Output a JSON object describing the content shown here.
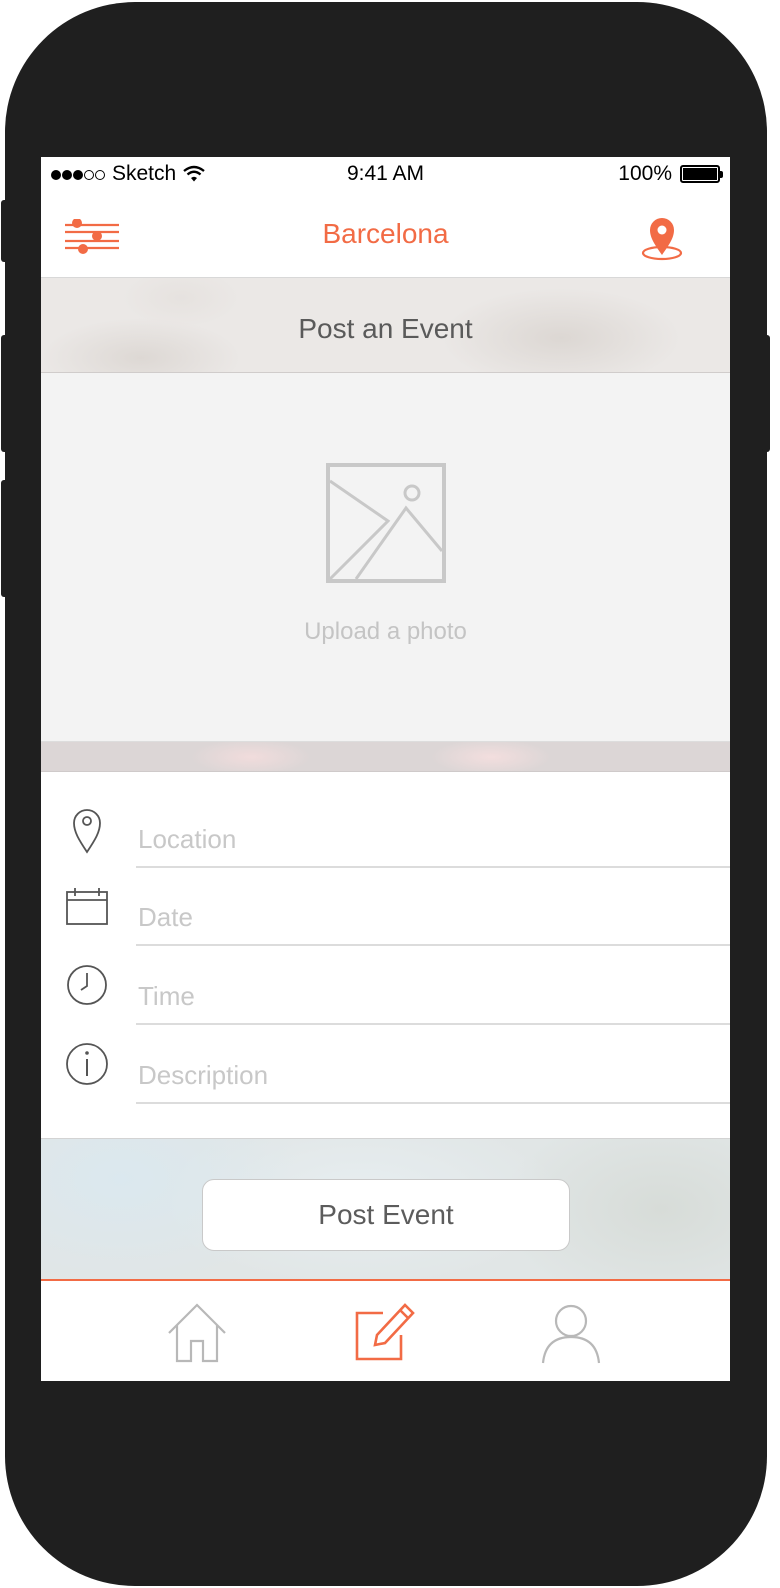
{
  "status_bar": {
    "carrier": "Sketch",
    "time": "9:41 AM",
    "battery": "100%"
  },
  "nav": {
    "title": "Barcelona",
    "left_icon": "filter-sliders-icon",
    "right_icon": "location-pin-icon"
  },
  "section": {
    "title": "Post an Event"
  },
  "upload": {
    "label": "Upload a photo",
    "icon": "image-placeholder-icon"
  },
  "form": {
    "fields": [
      {
        "placeholder": "Location",
        "icon": "location-pin-icon"
      },
      {
        "placeholder": "Date",
        "icon": "calendar-icon"
      },
      {
        "placeholder": "Time",
        "icon": "clock-icon"
      },
      {
        "placeholder": "Description",
        "icon": "info-icon"
      }
    ]
  },
  "actions": {
    "post_label": "Post Event"
  },
  "tabbar": {
    "items": [
      {
        "icon": "home-icon",
        "active": false
      },
      {
        "icon": "compose-icon",
        "active": true
      },
      {
        "icon": "profile-icon",
        "active": false
      }
    ]
  },
  "colors": {
    "accent": "#f26b45",
    "placeholder": "#c8c8c8",
    "icon_gray": "#b8b8b8"
  }
}
